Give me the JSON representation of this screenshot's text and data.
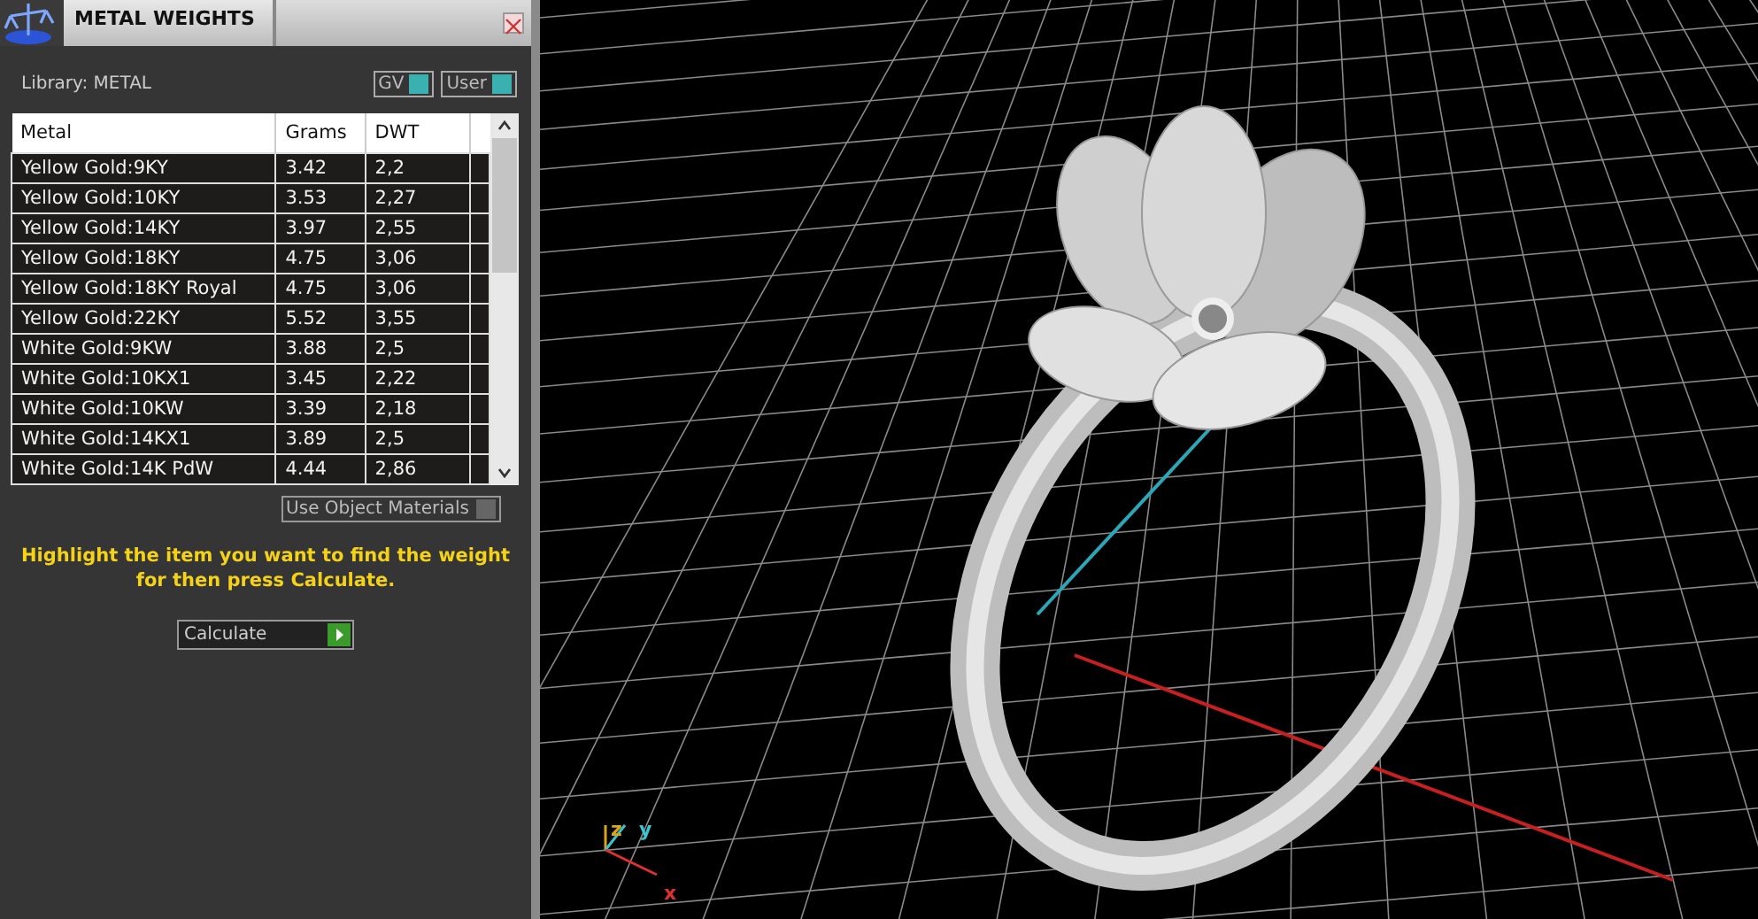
{
  "panel": {
    "title": "METAL WEIGHTS",
    "library": "Library: METAL",
    "toggles": [
      {
        "label": "GV",
        "on": true
      },
      {
        "label": "User",
        "on": true
      }
    ],
    "table": {
      "columns": [
        "Metal",
        "Grams",
        "DWT"
      ],
      "rows": [
        [
          "Yellow Gold:9KY",
          "3.42",
          "2,2"
        ],
        [
          "Yellow Gold:10KY",
          "3.53",
          "2,27"
        ],
        [
          "Yellow Gold:14KY",
          "3.97",
          "2,55"
        ],
        [
          "Yellow Gold:18KY",
          "4.75",
          "3,06"
        ],
        [
          "Yellow Gold:18KY Royal",
          "4.75",
          "3,06"
        ],
        [
          "Yellow Gold:22KY",
          "5.52",
          "3,55"
        ],
        [
          "White Gold:9KW",
          "3.88",
          "2,5"
        ],
        [
          "White Gold:10KX1",
          "3.45",
          "2,22"
        ],
        [
          "White Gold:10KW",
          "3.39",
          "2,18"
        ],
        [
          "White Gold:14KX1",
          "3.89",
          "2,5"
        ],
        [
          "White Gold:14K PdW",
          "4.44",
          "2,86"
        ]
      ]
    },
    "use_object_materials": {
      "label": "Use Object Materials",
      "on": false
    },
    "hint": "Highlight the item you want to find the weight for then press Calculate.",
    "calculate_button": "Calculate"
  },
  "viewport": {
    "axes": [
      "z",
      "y",
      "x"
    ]
  }
}
